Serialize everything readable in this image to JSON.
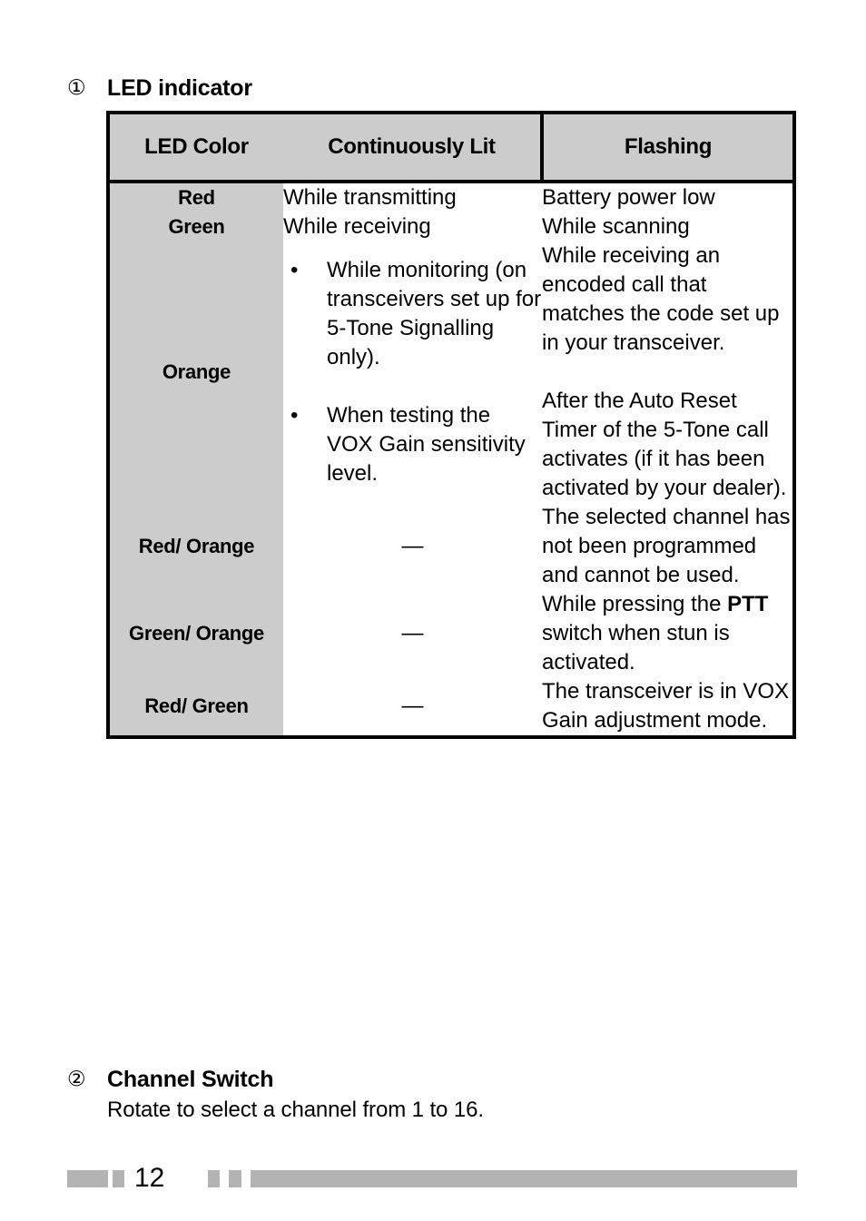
{
  "sections": [
    {
      "marker": "①",
      "title": "LED indicator"
    },
    {
      "marker": "②",
      "title": "Channel Switch",
      "body": "Rotate to select a channel from 1 to 16."
    }
  ],
  "table": {
    "headers": {
      "col1": "LED Color",
      "col2": "Continuously Lit",
      "col3": "Flashing"
    },
    "rows": [
      {
        "color": "Red",
        "lit": "While transmitting",
        "flashing": "Battery power low"
      },
      {
        "color": "Green",
        "lit": "While receiving",
        "flashing": "While scanning"
      },
      {
        "color": "Orange",
        "lit_bullets": [
          "While monitoring (on transceivers set up for 5-Tone Signalling only).",
          "When testing the VOX Gain sensitivity level."
        ],
        "flashing_paragraphs": [
          "While receiving an encoded call that matches the code set up in your transceiver.",
          "After the Auto Reset Timer of the 5-Tone call activates (if it has been activated by your dealer)."
        ]
      },
      {
        "color": "Red/ Orange",
        "lit": "—",
        "flashing": "The selected channel has not been programmed and cannot be used."
      },
      {
        "color": "Green/ Orange",
        "lit": "—",
        "flashing_prefix": "While pressing the ",
        "flashing_bold": "PTT",
        "flashing_suffix": " switch when stun is activated."
      },
      {
        "color": "Red/ Green",
        "lit": "—",
        "flashing": "The transceiver is in VOX Gain adjustment mode."
      }
    ],
    "bullet_glyph": "•"
  },
  "footer": {
    "page_number": "12"
  },
  "colors": {
    "header_fill": "#cccccc",
    "label_fill": "#cccccc",
    "footer_bar": "#b3b3b3",
    "border": "#000000",
    "text": "#000000"
  }
}
